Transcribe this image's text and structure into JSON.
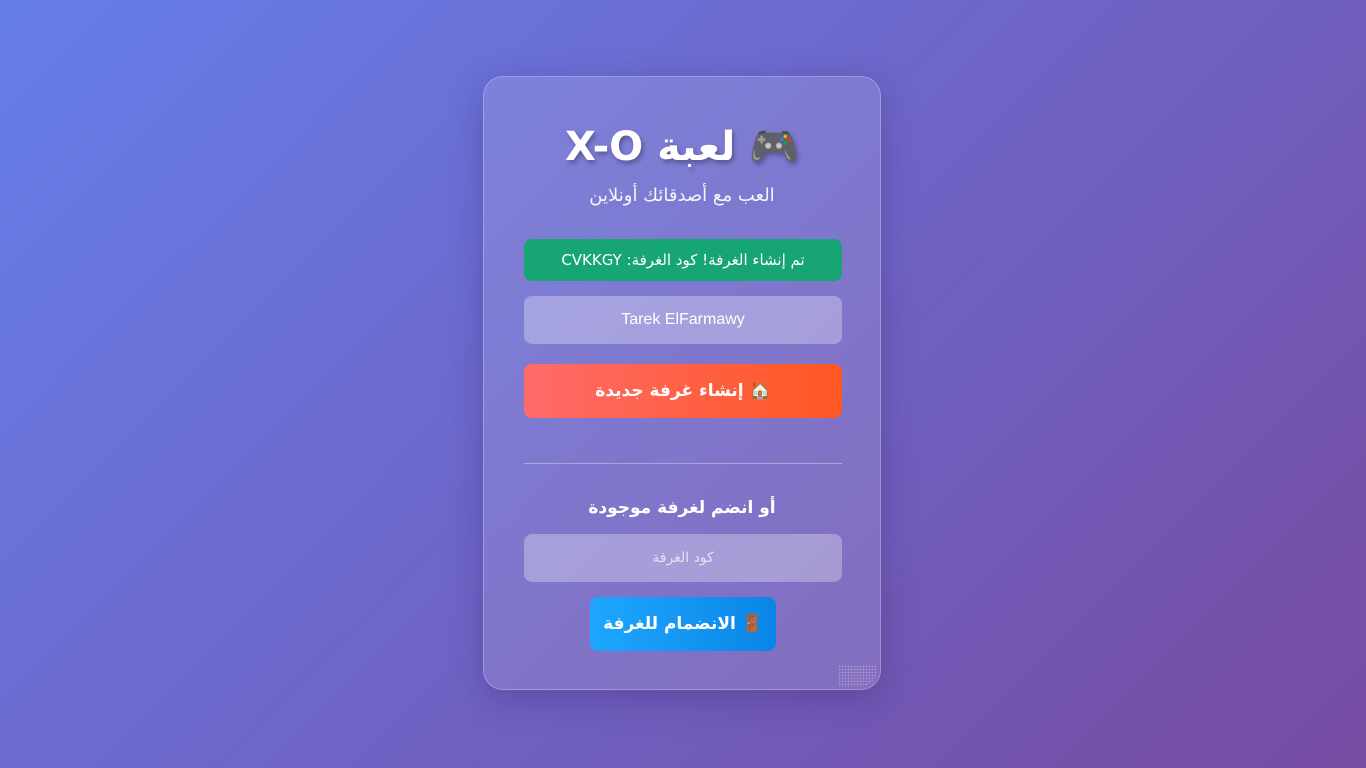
{
  "header": {
    "title": "🎮 لعبة X-O",
    "subtitle": "العب مع أصدقائك أونلاين"
  },
  "status": {
    "message": "تم إنشاء الغرفة! كود الغرفة: CVKKGY",
    "color": "#16a573"
  },
  "create": {
    "name_value": "Tarek ElFarmawy",
    "button_label": "🏠 إنشاء غرفة جديدة"
  },
  "join": {
    "heading": "أو انضم لغرفة موجودة",
    "code_placeholder": "كود الغرفة",
    "button_label": "🚪 الانضمام للغرفة"
  },
  "colors": {
    "background_start": "#667eea",
    "background_end": "#764ba2",
    "create_button": "#ff5722",
    "join_button": "#0a85e6"
  },
  "icons": {
    "title": "gamepad-icon",
    "create_button": "house-icon",
    "join_button": "door-icon"
  }
}
